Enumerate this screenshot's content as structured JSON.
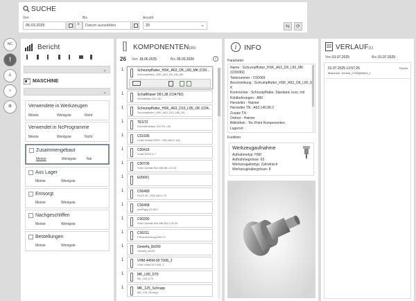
{
  "search": {
    "title": "SUCHE",
    "from_label": "Von",
    "from_value": "05.03.2025",
    "to_label": "Bis",
    "to_value": "Datum auswählen",
    "count_label": "Anzahl",
    "count_value": "20"
  },
  "sidebar": [
    {
      "label": "NC"
    },
    {
      "label": "!"
    },
    {
      "label": ""
    },
    {
      "label": ""
    },
    {
      "label": ""
    }
  ],
  "report": {
    "title": "Bericht",
    "machine_title": "MASCHINE",
    "groups": [
      {
        "title": "Verwendete in Werkzeugen",
        "subs": [
          "Meiste",
          "Wenigste",
          "Nicht"
        ]
      },
      {
        "title": "Verwendet in NcProgramme",
        "subs": [
          "Meiste",
          "Wenigste",
          "Nicht"
        ]
      },
      {
        "title": "Zusammengebaut",
        "subs": [
          "Meiste",
          "Wenigste",
          "Nie"
        ]
      },
      {
        "title": "Aus Lager",
        "subs": [
          "Meiste",
          "Wenigste"
        ]
      },
      {
        "title": "Entsorgt",
        "subs": [
          "Meiste",
          "Wenigste"
        ]
      },
      {
        "title": "Nachgeschliffen",
        "subs": [
          "Meiste",
          "Wenigste"
        ]
      },
      {
        "title": "Bestellungen",
        "subs": [
          "Meiste",
          "Wenigste"
        ]
      }
    ]
  },
  "components": {
    "title": "KOMPONENTEN",
    "count": "(20)",
    "total": "26",
    "from_label": "Von",
    "from_value": "18.06.2025",
    "to_label": "Bis",
    "to_value": "05.03.2026",
    "items": [
      {
        "num": "1",
        "t1": "Schrumpffutter_HSK_A63_D8_L80_MK (C00...",
        "t2": "Schrumpffutter_HSK_A63_D8_L80_MK"
      },
      {
        "num": "1",
        "t1": "Schaftfräser D8 L38 (C04792)",
        "t2": "Schaftfräser D8 L38"
      },
      {
        "num": "1",
        "t1": "Schrumpffutter_HSK_A63_D10_L85_OK (C04...",
        "t2": "Schrumpffutter_HSK_A63_D10_L85_OK"
      },
      {
        "num": "1",
        "t1": "TEST2",
        "t2": "Eckradienfräser D10 R1 L38"
      },
      {
        "num": "1",
        "t1": "C01936",
        "t2": "Collet Holder ER20 - HSK A63 x 100"
      },
      {
        "num": "1",
        "t1": "C00416",
        "t2": "Collet ER20 6-7"
      },
      {
        "num": "1",
        "t1": "C00706",
        "t2": "Solid Carbide Slot Mill Ø6 L19 Z4"
      },
      {
        "num": "1",
        "t1": "E00001",
        "t2": ""
      },
      {
        "num": "1",
        "t1": "C06489",
        "t2": "PG25 25 - HSK A63 x 79"
      },
      {
        "num": "1",
        "t1": "C06468",
        "t2": "powRgrip 25 Ø10"
      },
      {
        "num": "1",
        "t1": "C00390",
        "t2": "Solid Carbide Slot Mill Ø10 L26 Z4"
      },
      {
        "num": "1",
        "t1": "C06311",
        "t2": "Feinausrichtung Ø40 L0"
      },
      {
        "num": "1",
        "t1": "Gewefa_8x200",
        "t2": "Gewefa_8x200"
      },
      {
        "num": "1",
        "t1": "VHM 445M-08 T008_2",
        "t2": "VHM 445M-08 T008_2"
      },
      {
        "num": "1",
        "t1": "MK_L89_D70",
        "t2": "MK_L89_D70"
      },
      {
        "num": "1",
        "t1": "MK_125_Schrupp",
        "t2": "MK_125_Schrupp"
      }
    ]
  },
  "info": {
    "title": "INFO",
    "param_label": "Parameter",
    "lines": [
      "Name : Schrumpffutter_HSK_A63_D8_L80_MK",
      "          (C00069)",
      "Teilenummer : C00069",
      "Beschreibung : Schrumpffutter_HSK_A63_D8_L80_M",
      "          K",
      "Kommentar : Schrumpffutter, Standard, kurz, mit",
      "          Kühlbohrungen - A80",
      "Hersteller : Haimer",
      "Hersteller TN : A63.140.08.2",
      "Zusatz TN :",
      "Ordner : Haimer",
      "Bibliothek : Tec.Point Komponenten",
      "Lagerort :"
    ],
    "function_label": "Funktion",
    "func_title": "Werkzeugaufnahme",
    "func_lines": [
      "Aufnahmetyp: HSK",
      "Aufnahmegrösse: 63",
      "Werkzeugaltertyp: Zylindrisch",
      "Werkzeughaltergrösse: 8"
    ]
  },
  "history": {
    "title": "VERLAUF",
    "count": "(1)",
    "from_label": "Von",
    "from_value": "01.07.2025",
    "to_label": "Bis",
    "to_value": "01.07.2025",
    "entry_time": "01.07.2025 13:57:25",
    "entry_action": "Florian",
    "entry_machine": "Maschine: Hermle_C320@MAG_1"
  }
}
